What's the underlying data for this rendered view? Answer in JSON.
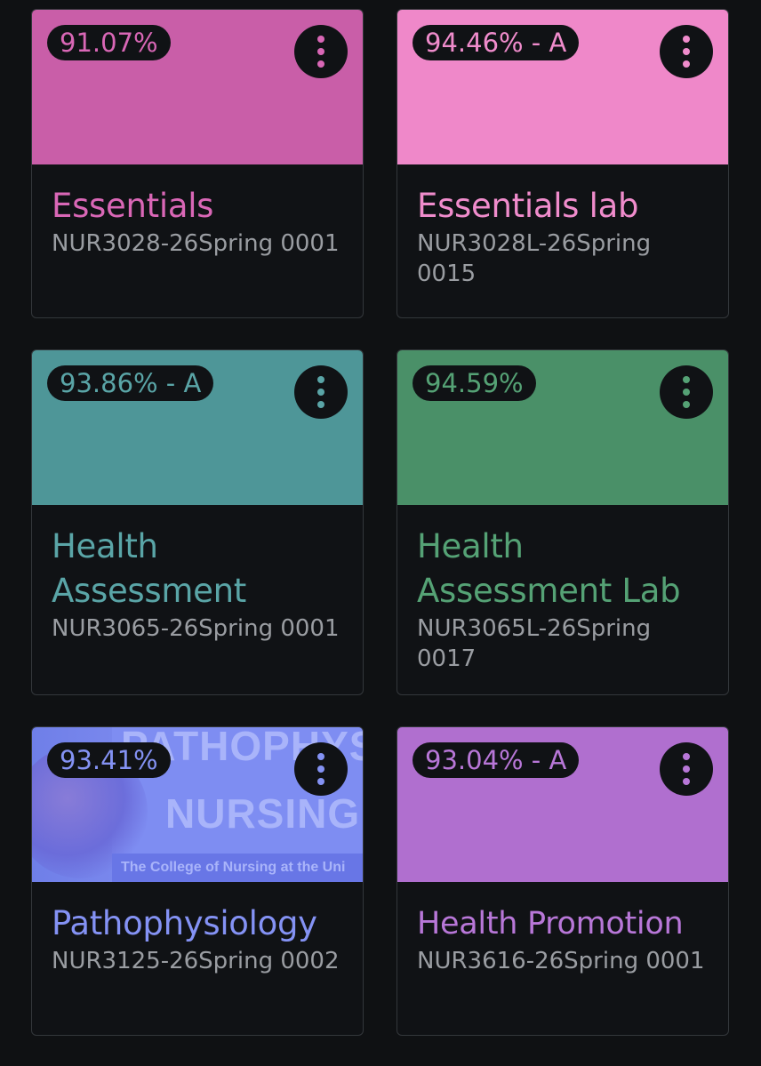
{
  "courses": [
    {
      "grade": "91.07%",
      "title": "Essentials",
      "code": "NUR3028-26Spring 0001",
      "color": "#c95ea8",
      "accent": "#d967b6"
    },
    {
      "grade": "94.46% - A",
      "title": "Essentials lab",
      "code": "NUR3028L-26Spring 0015",
      "color": "#ef88c9",
      "accent": "#f08ccc"
    },
    {
      "grade": "93.86% - A",
      "title": "Health Assessment",
      "code": "NUR3065-26Spring 0001",
      "color": "#4e9698",
      "accent": "#5aa5a7"
    },
    {
      "grade": "94.59%",
      "title": "Health Assessment Lab",
      "code": "NUR3065L-26Spring 0017",
      "color": "#4a9068",
      "accent": "#55a275"
    },
    {
      "grade": "93.41%",
      "title": "Pathophysiology",
      "code": "NUR3125-26Spring 0002",
      "color": "#7b88ee",
      "accent": "#8492f4",
      "banner_image_text": [
        "PATHOPHYSIO",
        "NURSING PI",
        "The College of Nursing at the Uni"
      ]
    },
    {
      "grade": "93.04% - A",
      "title": "Health Promotion",
      "code": "NUR3616-26Spring 0001",
      "color": "#b06fcf",
      "accent": "#b877d8"
    }
  ],
  "icons": {
    "menu": "more-vertical-icon"
  }
}
